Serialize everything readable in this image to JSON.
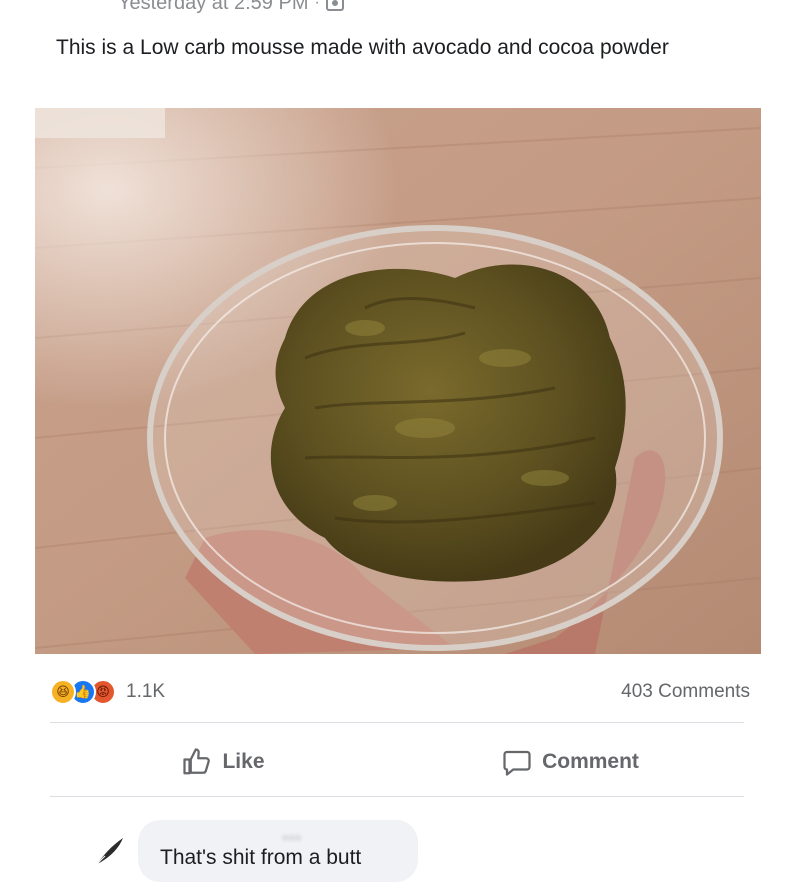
{
  "post": {
    "timestamp": "Yesterday at 2:59 PM",
    "separator": "·",
    "audience_icon": "friends-icon",
    "text": "This is a Low carb mousse made with avocado and cocoa powder"
  },
  "stats": {
    "reactions": [
      {
        "type": "haha",
        "glyph": "😆"
      },
      {
        "type": "like",
        "glyph": "👍"
      },
      {
        "type": "angry",
        "glyph": "😡"
      }
    ],
    "reaction_count": "1.1K",
    "comment_count": "403 Comments"
  },
  "actions": {
    "like_label": "Like",
    "comment_label": "Comment"
  },
  "comment": {
    "author": "...",
    "text": "That's shit from a butt"
  },
  "colors": {
    "text_primary": "#1c1e21",
    "text_secondary": "#65676b",
    "divider": "#dadde1",
    "bubble": "#f0f2f5",
    "like_blue": "#1877f2"
  }
}
